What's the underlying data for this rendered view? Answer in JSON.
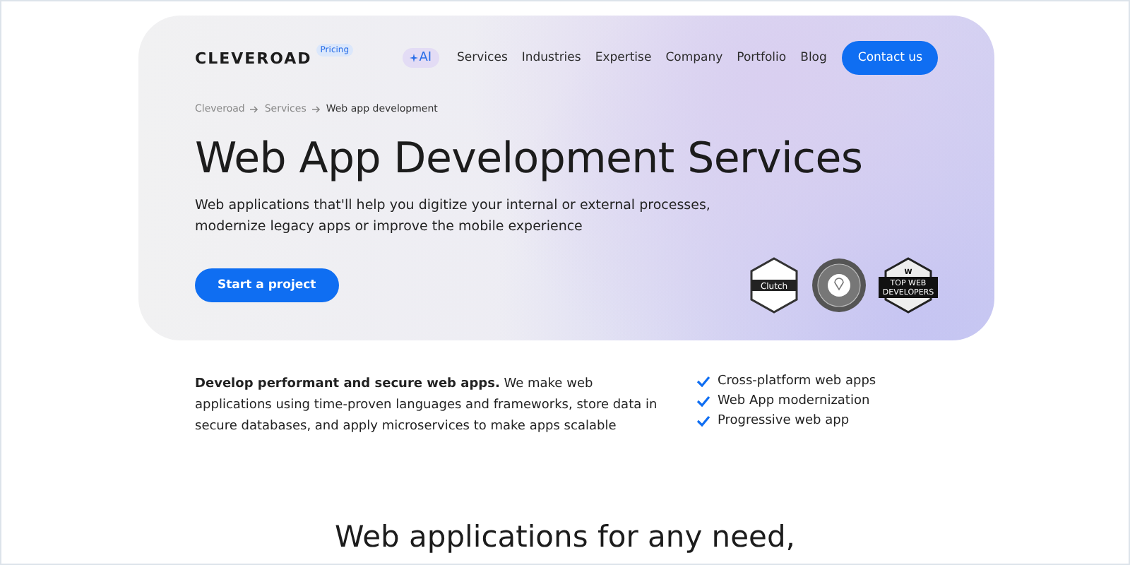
{
  "header": {
    "logo": "CLEVEROAD",
    "logo_badge": "Pricing",
    "ai_label": "AI",
    "nav": [
      "Services",
      "Industries",
      "Expertise",
      "Company",
      "Portfolio",
      "Blog"
    ],
    "cta": "Contact us"
  },
  "breadcrumbs": [
    "Cleveroad",
    "Services",
    "Web app development"
  ],
  "hero": {
    "title": "Web App Development Services",
    "subtitle": "Web applications that'll help you digitize your internal or external processes, modernize legacy apps or improve the mobile experience",
    "button": "Start a project",
    "badges": [
      {
        "kind": "clutch",
        "label": "Clutch"
      },
      {
        "kind": "round"
      },
      {
        "kind": "ribbon",
        "top": "W",
        "lines": [
          "TOP WEB",
          "DEVELOPERS"
        ]
      }
    ]
  },
  "intro": {
    "text": "**Develop performant and secure web apps.** We make web applications using time-proven languages and frameworks, store data in secure databases, and apply microservices to make apps scalable",
    "features": [
      "Cross-platform web apps",
      "Web App modernization",
      "Progressive web app"
    ]
  },
  "section_title": "Web applications for any need,"
}
